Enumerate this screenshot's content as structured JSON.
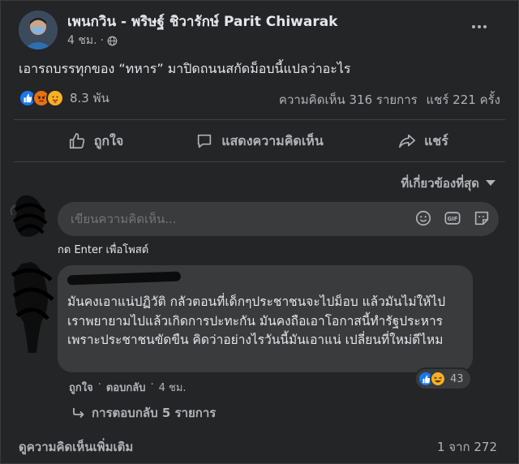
{
  "post": {
    "author": "เพนกวิน - พริษฐ์ ชิวารักษ์ Parit Chiwarak",
    "time": "4 ชม.",
    "privacy_icon": "globe-icon",
    "text": "เอารถบรรทุกของ “ทหาร” มาปิดถนนสกัดม็อบนี้แปลว่าอะไร",
    "reactions": [
      "like",
      "angry",
      "care"
    ],
    "reaction_count": "8.3 พัน",
    "comments_stat": "ความคิดเห็น 316 รายการ",
    "shares_stat": "แชร์ 221 ครั้ง"
  },
  "actions": {
    "like": "ถูกใจ",
    "comment": "แสดงความคิดเห็น",
    "share": "แชร์"
  },
  "sort_label": "ที่เกี่ยวข้องที่สุด",
  "composer": {
    "placeholder": "เขียนความคิดเห็น...",
    "hint": "กด Enter เพื่อโพสต์"
  },
  "comment": {
    "text": "มันคงเอาแน่ปฏิวัติ กลัวตอนที่เด็กๆประชาชนจะไปม็อบ แล้วมันไม่ให้ไป เราพยายามไปแล้วเกิดการปะทะกัน มันคงถือเอาโอกาสนี้ทำรัฐประหารเพราะประชาชนขัดขืน คิดว่าอย่างไรวันนี้มันเอาแน่ เปลี่ยนที่ใหม่ดีไหม",
    "reactions": [
      "like",
      "haha"
    ],
    "reaction_count": "43",
    "like_label": "ถูกใจ",
    "sep": "·",
    "reply_label": "ตอบกลับ",
    "time": "4 ชม.",
    "replies_label": "การตอบกลับ 5 รายการ"
  },
  "footer": {
    "more_comments": "ดูความคิดเห็นเพิ่มเติม",
    "pager": "1 จาก 272"
  },
  "colors": {
    "background": "#242526",
    "bubble": "#3a3b3c",
    "text": "#e4e6eb",
    "muted": "#b0b3b8",
    "like": "#1877f2",
    "angry": "#e9710f",
    "haha": "#f7b125"
  }
}
